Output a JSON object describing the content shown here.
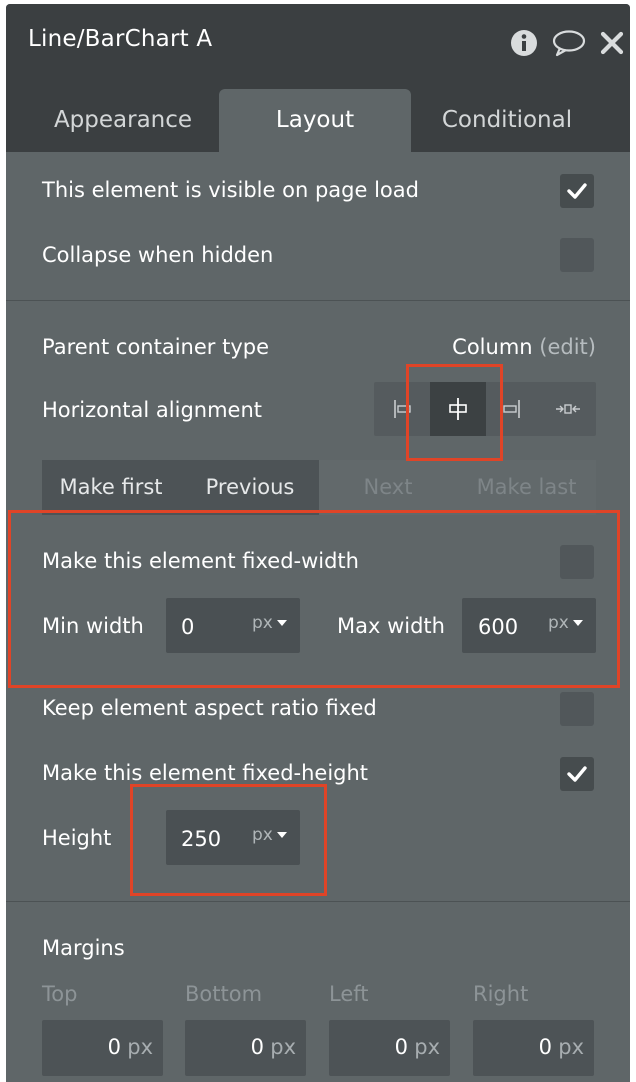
{
  "window": {
    "title": "Line/BarChart A",
    "icons": [
      "info-icon",
      "comment-icon",
      "close-icon"
    ]
  },
  "tabs": [
    {
      "label": "Appearance",
      "active": false
    },
    {
      "label": "Layout",
      "active": true
    },
    {
      "label": "Conditional",
      "active": false
    }
  ],
  "visibility": {
    "visible_on_load_label": "This element is visible on page load",
    "visible_on_load_checked": true,
    "collapse_label": "Collapse when hidden",
    "collapse_checked": false
  },
  "container": {
    "parent_type_label": "Parent container type",
    "parent_type_value": "Column",
    "edit_label": "(edit)",
    "h_align_label": "Horizontal alignment",
    "alignment_options": [
      "align-left-icon",
      "align-center-icon",
      "align-right-icon",
      "align-stretch-icon"
    ],
    "alignment_selected": "align-center-icon"
  },
  "order": {
    "make_first": "Make first",
    "previous": "Previous",
    "next": "Next",
    "make_last": "Make last"
  },
  "width": {
    "fixed_width_label": "Make this element fixed-width",
    "fixed_width_checked": false,
    "min_label": "Min width",
    "min_value": "0",
    "min_unit": "px",
    "max_label": "Max width",
    "max_value": "600",
    "max_unit": "px"
  },
  "aspect": {
    "label": "Keep element aspect ratio fixed",
    "checked": false
  },
  "height": {
    "fixed_height_label": "Make this element fixed-height",
    "fixed_height_checked": true,
    "label": "Height",
    "value": "250",
    "unit": "px"
  },
  "margins": {
    "title": "Margins",
    "fields": [
      {
        "label": "Top",
        "value": "0",
        "unit": "px"
      },
      {
        "label": "Bottom",
        "value": "0",
        "unit": "px"
      },
      {
        "label": "Left",
        "value": "0",
        "unit": "px"
      },
      {
        "label": "Right",
        "value": "0",
        "unit": "px"
      }
    ]
  },
  "colors": {
    "panel_bg": "#5f6668",
    "header_bg": "#3b3f41",
    "annotation": "#e04427"
  }
}
